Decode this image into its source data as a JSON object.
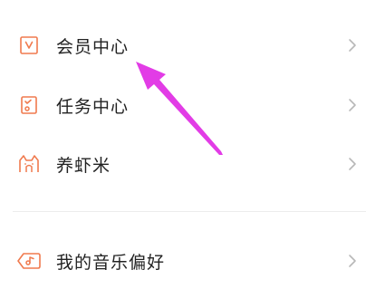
{
  "menu": {
    "items": [
      {
        "label": "会员中心",
        "icon": "vip-v-icon"
      },
      {
        "label": "任务中心",
        "icon": "task-clipboard-icon"
      },
      {
        "label": "养虾米",
        "icon": "shrimp-cat-icon"
      },
      {
        "label": "我的音乐偏好",
        "icon": "music-tag-icon"
      }
    ]
  },
  "colors": {
    "accent": "#f07a4e",
    "text": "#222222",
    "chevron": "#b8b8b8",
    "annotation_arrow": "#e23ce6"
  }
}
